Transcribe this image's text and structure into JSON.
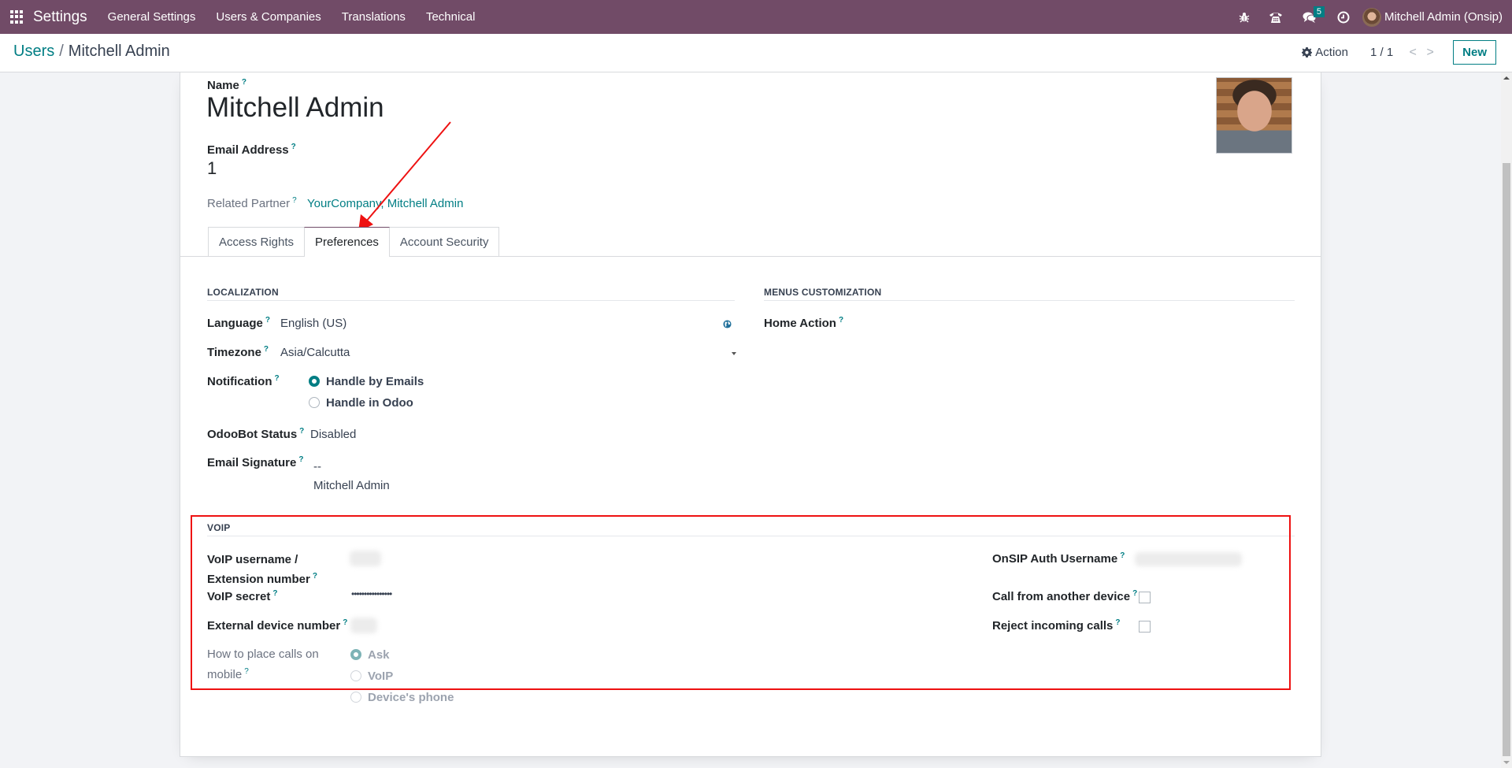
{
  "navbar": {
    "app_name": "Settings",
    "menu": [
      "General Settings",
      "Users & Companies",
      "Translations",
      "Technical"
    ],
    "icons": [
      "debug-bug-icon",
      "voip-phone-icon",
      "messaging-chat-icon",
      "activity-clock-icon"
    ],
    "messages_badge": "5",
    "user": "Mitchell Admin (Onsip)"
  },
  "control_panel": {
    "breadcrumb": {
      "parent": "Users",
      "separator": "/",
      "current": "Mitchell Admin"
    },
    "action_label": "Action",
    "pager": "1 / 1",
    "pager_prev": "<",
    "pager_next": ">",
    "new_label": "New"
  },
  "form": {
    "name_label": "Name",
    "name_value": "Mitchell Admin",
    "email_label": "Email Address",
    "email_value": "1",
    "partner_label": "Related Partner",
    "partner_value": "YourCompany, Mitchell Admin",
    "help_mark": "?",
    "tabs": [
      {
        "label": "Access Rights",
        "active": false
      },
      {
        "label": "Preferences",
        "active": true
      },
      {
        "label": "Account Security",
        "active": false
      }
    ],
    "localization": {
      "title": "LOCALIZATION",
      "language_label": "Language",
      "language_value": "English (US)",
      "timezone_label": "Timezone",
      "timezone_value": "Asia/Calcutta",
      "notification_label": "Notification",
      "notification_options": [
        {
          "label": "Handle by Emails",
          "checked": true
        },
        {
          "label": "Handle in Odoo",
          "checked": false
        }
      ],
      "odoobot_label": "OdooBot Status",
      "odoobot_value": "Disabled",
      "signature_label": "Email Signature",
      "signature_lines": [
        "--",
        "Mitchell Admin"
      ]
    },
    "menus_customization": {
      "title": "MENUS CUSTOMIZATION",
      "home_action_label": "Home Action",
      "home_action_value": ""
    },
    "voip": {
      "title": "VOIP",
      "username_label_line1": "VoIP username /",
      "username_label_line2": "Extension number",
      "username_value": "(blurred)",
      "secret_label": "VoIP secret",
      "secret_value": "••••••••••••••••",
      "external_label": "External device number",
      "external_value": "(blurred)",
      "mobile_label_line1": "How to place calls on",
      "mobile_label_line2": "mobile",
      "mobile_options": [
        {
          "label": "Ask",
          "checked": true
        },
        {
          "label": "VoIP",
          "checked": false
        },
        {
          "label": "Device's phone",
          "checked": false
        }
      ],
      "onsip_label": "OnSIP Auth Username",
      "onsip_value": "(blurred)",
      "call_other_device_label": "Call from another device",
      "call_other_device_checked": false,
      "reject_calls_label": "Reject incoming calls",
      "reject_calls_checked": false
    }
  },
  "annotations": {
    "highlight_color": "#ee1111",
    "arrow_target": "Preferences tab",
    "highlight_target": "VOIP section"
  },
  "colors": {
    "brand": "#714B67",
    "accent": "#017e84"
  }
}
